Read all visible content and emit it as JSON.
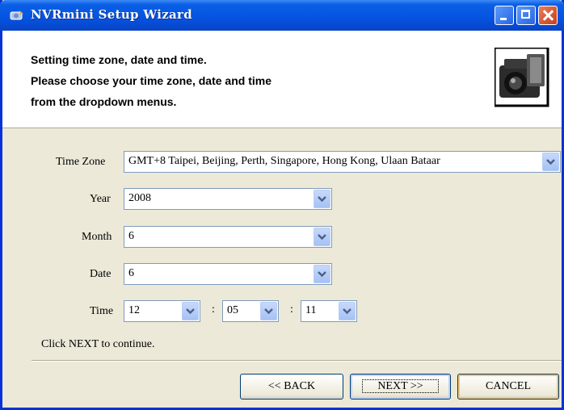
{
  "window": {
    "title": "NVRmini Setup Wizard"
  },
  "header": {
    "line1": "Setting time zone, date and time.",
    "line2": "Please choose your time zone, date and time",
    "line3": "from the dropdown menus."
  },
  "form": {
    "timezone_label": "Time Zone",
    "timezone_value": "GMT+8 Taipei, Beijing, Perth, Singapore, Hong Kong, Ulaan Bataar",
    "year_label": "Year",
    "year_value": "2008",
    "month_label": "Month",
    "month_value": "6",
    "date_label": "Date",
    "date_value": "6",
    "time_label": "Time",
    "hour_value": "12",
    "minute_value": "05",
    "second_value": "11",
    "separator": ":"
  },
  "status": "Click NEXT to continue.",
  "buttons": {
    "back": "<< BACK",
    "next": "NEXT >>",
    "cancel": "CANCEL"
  },
  "colors": {
    "titlebar": "#0553e0",
    "face": "#ece9d8",
    "combo_border": "#7f9db9"
  }
}
